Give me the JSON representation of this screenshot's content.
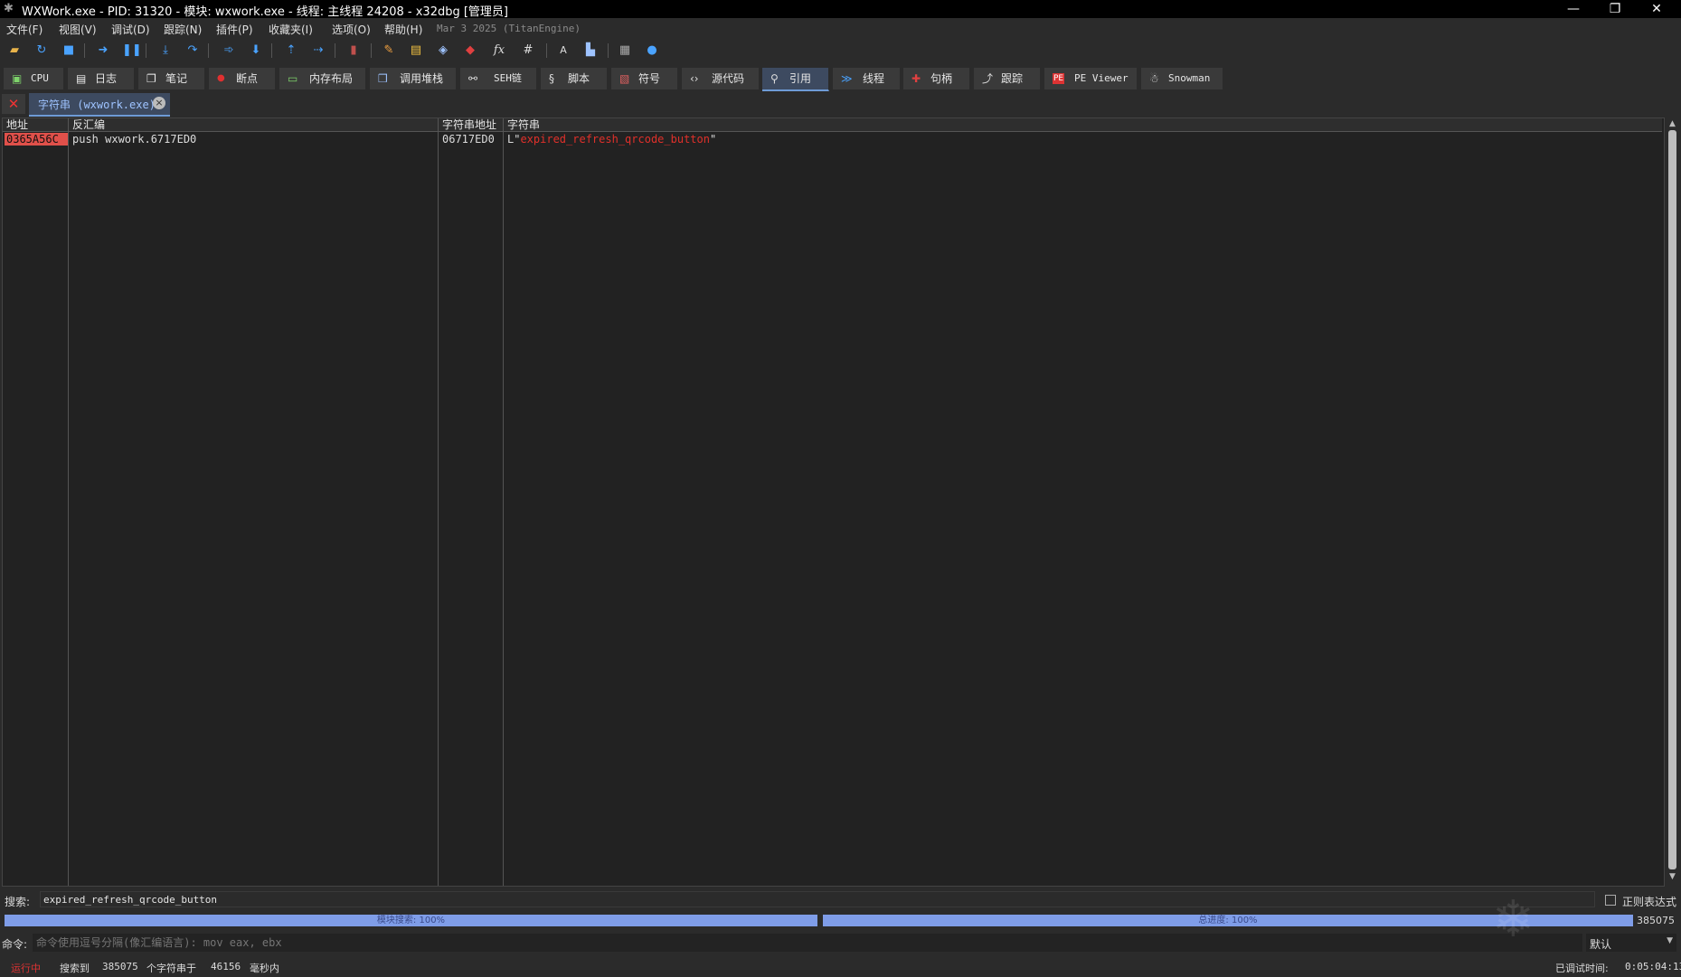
{
  "window": {
    "title": "WXWork.exe - PID: 31320 - 模块: wxwork.exe - 线程: 主线程 24208 - x32dbg [管理员]",
    "controls": [
      "—",
      "❐",
      "✕"
    ]
  },
  "menu": {
    "items": [
      "文件(F)",
      "视图(V)",
      "调试(D)",
      "跟踪(N)",
      "插件(P)",
      "收藏夹(I)",
      "选项(O)",
      "帮助(H)"
    ],
    "build": "Mar 3 2025 (TitanEngine)"
  },
  "toolbar": {
    "icons": [
      "open-icon",
      "restart-icon",
      "stop-icon",
      "run-icon",
      "pause-icon",
      "step-into-icon",
      "step-over-icon",
      "trace-into-icon",
      "trace-over-icon",
      "execute-till-return-icon",
      "run-to-user-code-icon",
      "scylla-icon",
      "patch-icon",
      "comment-icon",
      "label-icon",
      "bookmark-icon",
      "function-icon",
      "hash-icon",
      "font-icon",
      "highlight-icon",
      "calculator-icon",
      "help-icon"
    ],
    "fx_glyph": "fx",
    "hash_glyph": "#",
    "font_glyph": "A"
  },
  "tabs": [
    {
      "label": "CPU",
      "icon": "cpu-icon",
      "active": false
    },
    {
      "label": "日志",
      "icon": "log-icon",
      "active": false
    },
    {
      "label": "笔记",
      "icon": "notes-icon",
      "active": false
    },
    {
      "label": "断点",
      "icon": "breakpoint-icon",
      "active": false
    },
    {
      "label": "内存布局",
      "icon": "memory-map-icon",
      "active": false
    },
    {
      "label": "调用堆栈",
      "icon": "call-stack-icon",
      "active": false
    },
    {
      "label": "SEH链",
      "icon": "seh-icon",
      "active": false
    },
    {
      "label": "脚本",
      "icon": "script-icon",
      "active": false
    },
    {
      "label": "符号",
      "icon": "symbols-icon",
      "active": false
    },
    {
      "label": "源代码",
      "icon": "source-icon",
      "active": false
    },
    {
      "label": "引用",
      "icon": "references-icon",
      "active": true
    },
    {
      "label": "线程",
      "icon": "threads-icon",
      "active": false
    },
    {
      "label": "句柄",
      "icon": "handles-icon",
      "active": false
    },
    {
      "label": "跟踪",
      "icon": "trace-icon",
      "active": false
    },
    {
      "label": "PE Viewer",
      "icon": "pe-viewer-icon",
      "active": false
    },
    {
      "label": "Snowman",
      "icon": "snowman-icon",
      "active": false
    }
  ],
  "subtab": {
    "label": "字符串 (wxwork.exe)"
  },
  "table": {
    "columns": [
      "地址",
      "反汇编",
      "字符串地址",
      "字符串"
    ],
    "rows": [
      {
        "address": "0365A56C",
        "disasm": "push wxwork.6717ED0",
        "string_address": "06717ED0",
        "string_prefix": "L\"",
        "string_value": "expired_refresh_qrcode_button",
        "string_suffix": "\""
      }
    ]
  },
  "search": {
    "label": "搜索:",
    "value": "expired_refresh_qrcode_button",
    "regex_label": "正则表达式",
    "regex_checked": false
  },
  "progress": {
    "module": {
      "label": "模块搜索: 100%",
      "fraction": 1.0
    },
    "total": {
      "label": "总进度: 100%",
      "fraction": 1.0
    },
    "count": "385075"
  },
  "command": {
    "label": "命令:",
    "placeholder": "命令使用逗号分隔(像汇编语言): mov eax, ebx",
    "mode": "默认"
  },
  "status": {
    "state": "运行中",
    "found_label": "搜索到",
    "found_count": "385075",
    "strings_in": "个字符串于",
    "ms": "46156",
    "ms_label": "毫秒内",
    "debug_time_label": "已调试时间:",
    "debug_time": "0:05:04:13"
  },
  "colors": {
    "background": "#2b2b2b",
    "table_bg": "#222222",
    "selected_address_bg": "#e0504a",
    "string_red": "#e0302a",
    "active_tab": "#3d4a60",
    "progress_fill": "#7f9de8"
  }
}
